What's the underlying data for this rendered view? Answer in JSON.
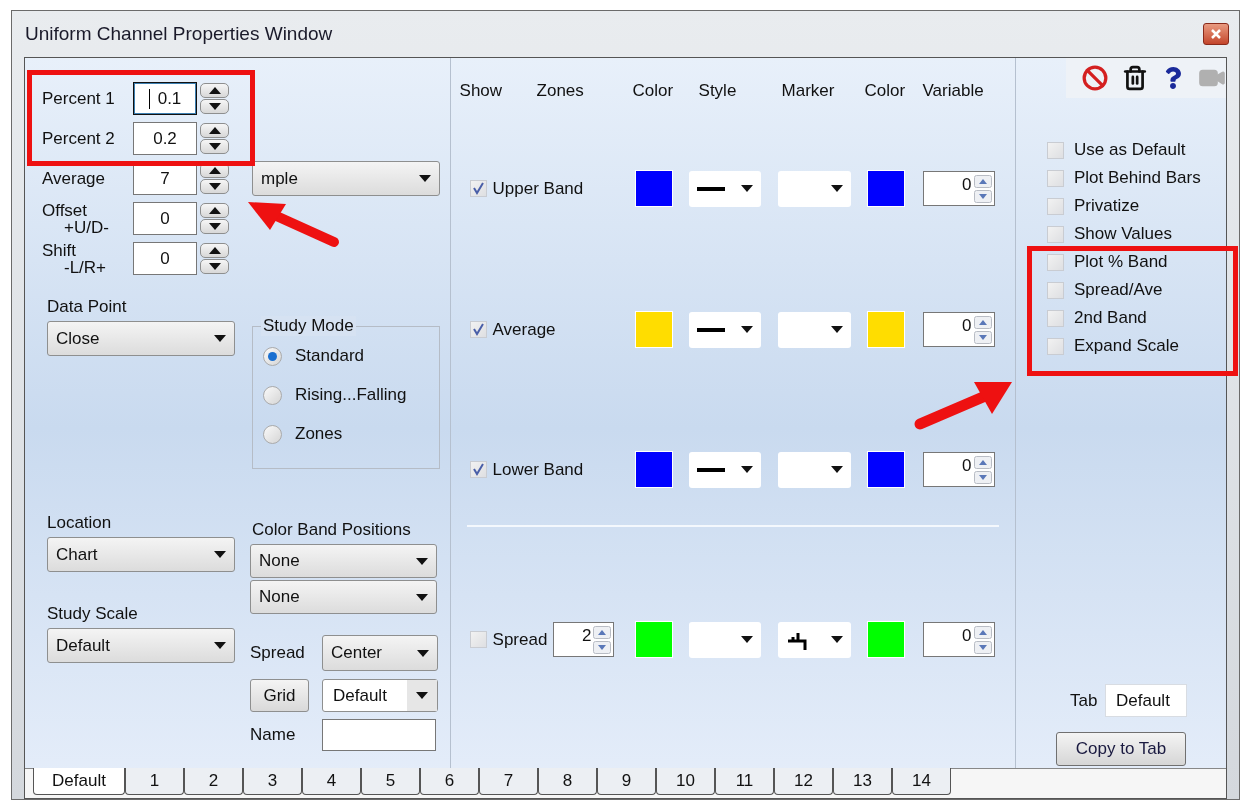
{
  "window": {
    "title": "Uniform Channel Properties Window"
  },
  "left": {
    "spinners": [
      {
        "label_lines": [
          "Percent 1"
        ],
        "value": "0.1",
        "focused": true
      },
      {
        "label_lines": [
          "Percent 2"
        ],
        "value": "0.2",
        "focused": false
      },
      {
        "label_lines": [
          "Average"
        ],
        "value": "7",
        "focused": false
      },
      {
        "label_lines": [
          "Offset",
          "+U/D-"
        ],
        "value": "0",
        "focused": false
      },
      {
        "label_lines": [
          "Shift",
          "-L/R+"
        ],
        "value": "0",
        "focused": false
      }
    ],
    "average_type": {
      "value": "mple"
    },
    "data_point": {
      "label": "Data Point",
      "value": "Close"
    },
    "study_mode": {
      "title": "Study Mode",
      "options": [
        {
          "label": "Standard",
          "selected": true
        },
        {
          "label": "Rising...Falling",
          "selected": false
        },
        {
          "label": "Zones",
          "selected": false
        }
      ]
    },
    "location": {
      "label": "Location",
      "value": "Chart"
    },
    "color_band_positions": {
      "label": "Color Band Positions",
      "values": [
        "None",
        "None"
      ]
    },
    "study_scale": {
      "label": "Study Scale",
      "value": "Default"
    },
    "spread": {
      "label": "Spread",
      "value": "Center"
    },
    "grid_button": "Grid",
    "grid_style": "Default",
    "name": {
      "label": "Name"
    }
  },
  "plots": {
    "columns": [
      "Show",
      "Zones",
      "Color",
      "Style",
      "Marker",
      "Color",
      "Variable"
    ],
    "rows": [
      {
        "kind": "band",
        "label": "Upper Band",
        "checked": true,
        "color": "#0000ff",
        "variable": "0"
      },
      {
        "kind": "band",
        "label": "Average",
        "checked": true,
        "color": "#ffdd00",
        "variable": "0"
      },
      {
        "kind": "band",
        "label": "Lower Band",
        "checked": true,
        "color": "#0000ff",
        "variable": "0"
      },
      {
        "kind": "spread",
        "label": "Spread",
        "checked": false,
        "period": "2",
        "color": "#00ff00",
        "variable": "0"
      }
    ]
  },
  "right": {
    "options": [
      {
        "label": "Use as Default",
        "checked": false
      },
      {
        "label": "Plot Behind Bars",
        "checked": false
      },
      {
        "label": "Privatize",
        "checked": false
      },
      {
        "label": "Show Values",
        "checked": false
      },
      {
        "label": "Plot % Band",
        "checked": false
      },
      {
        "label": "Spread/Ave",
        "checked": false
      },
      {
        "label": "2nd Band",
        "checked": false
      },
      {
        "label": "Expand Scale",
        "checked": false
      }
    ],
    "tab": {
      "label": "Tab",
      "value": "Default"
    },
    "copy_button": "Copy to Tab"
  },
  "tabs": [
    {
      "label": "Default",
      "selected": true
    },
    {
      "label": "1",
      "selected": false
    },
    {
      "label": "2",
      "selected": false
    },
    {
      "label": "3",
      "selected": false
    },
    {
      "label": "4",
      "selected": false
    },
    {
      "label": "5",
      "selected": false
    },
    {
      "label": "6",
      "selected": false
    },
    {
      "label": "7",
      "selected": false
    },
    {
      "label": "8",
      "selected": false
    },
    {
      "label": "9",
      "selected": false
    },
    {
      "label": "10",
      "selected": false
    },
    {
      "label": "11",
      "selected": false
    },
    {
      "label": "12",
      "selected": false
    },
    {
      "label": "13",
      "selected": false
    },
    {
      "label": "14",
      "selected": false
    }
  ]
}
